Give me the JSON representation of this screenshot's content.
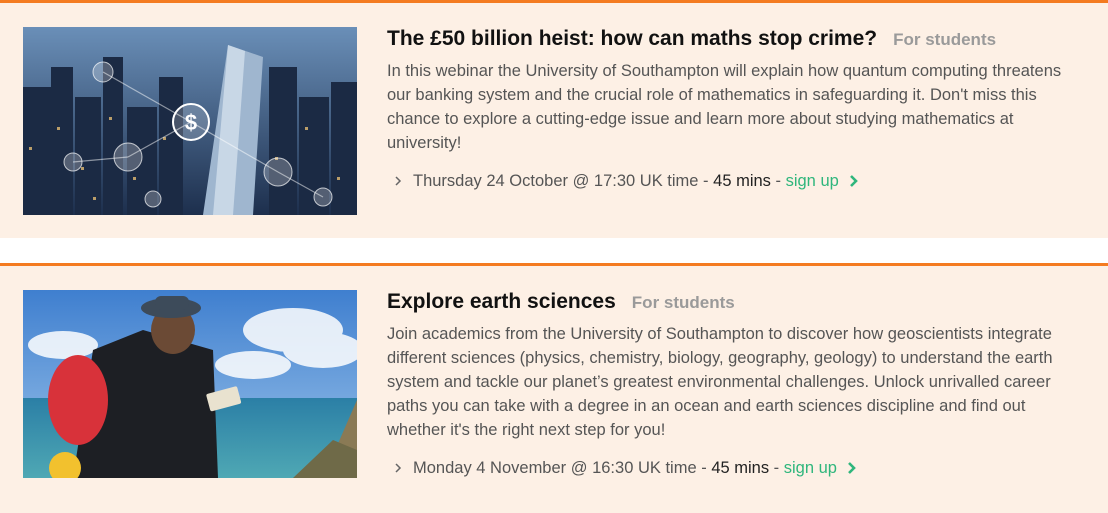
{
  "events": [
    {
      "title": "The £50 billion heist: how can maths stop crime?",
      "tag": "For students",
      "description": "In this webinar the University of Southampton will explain how quantum computing threatens our banking system and the crucial role of mathematics in safeguarding it. Don't miss this chance to explore a cutting-edge issue and learn more about studying mathematics at university!",
      "date": "Thursday 24 October @ 17:30 UK time",
      "sep1": " - ",
      "duration": "45 mins",
      "sep2": " - ",
      "signup_label": "sign up"
    },
    {
      "title": "Explore earth sciences",
      "tag": "For students",
      "description": "Join academics from the University of Southampton to discover how geoscientists integrate different sciences (physics, chemistry, biology, geography, geology) to understand the earth system and tackle our planet’s greatest environmental challenges. Unlock unrivalled career paths you can take with a degree in an ocean and earth sciences discipline and find out whether it's the right next step for you!",
      "date": "Monday 4 November @ 16:30 UK time",
      "sep1": " - ",
      "duration": "45 mins",
      "sep2": " - ",
      "signup_label": "sign up"
    }
  ],
  "colors": {
    "accent": "#f47b20",
    "card_bg": "#fdf0e5",
    "link": "#2fb67c",
    "tag": "#9a9a9a"
  }
}
